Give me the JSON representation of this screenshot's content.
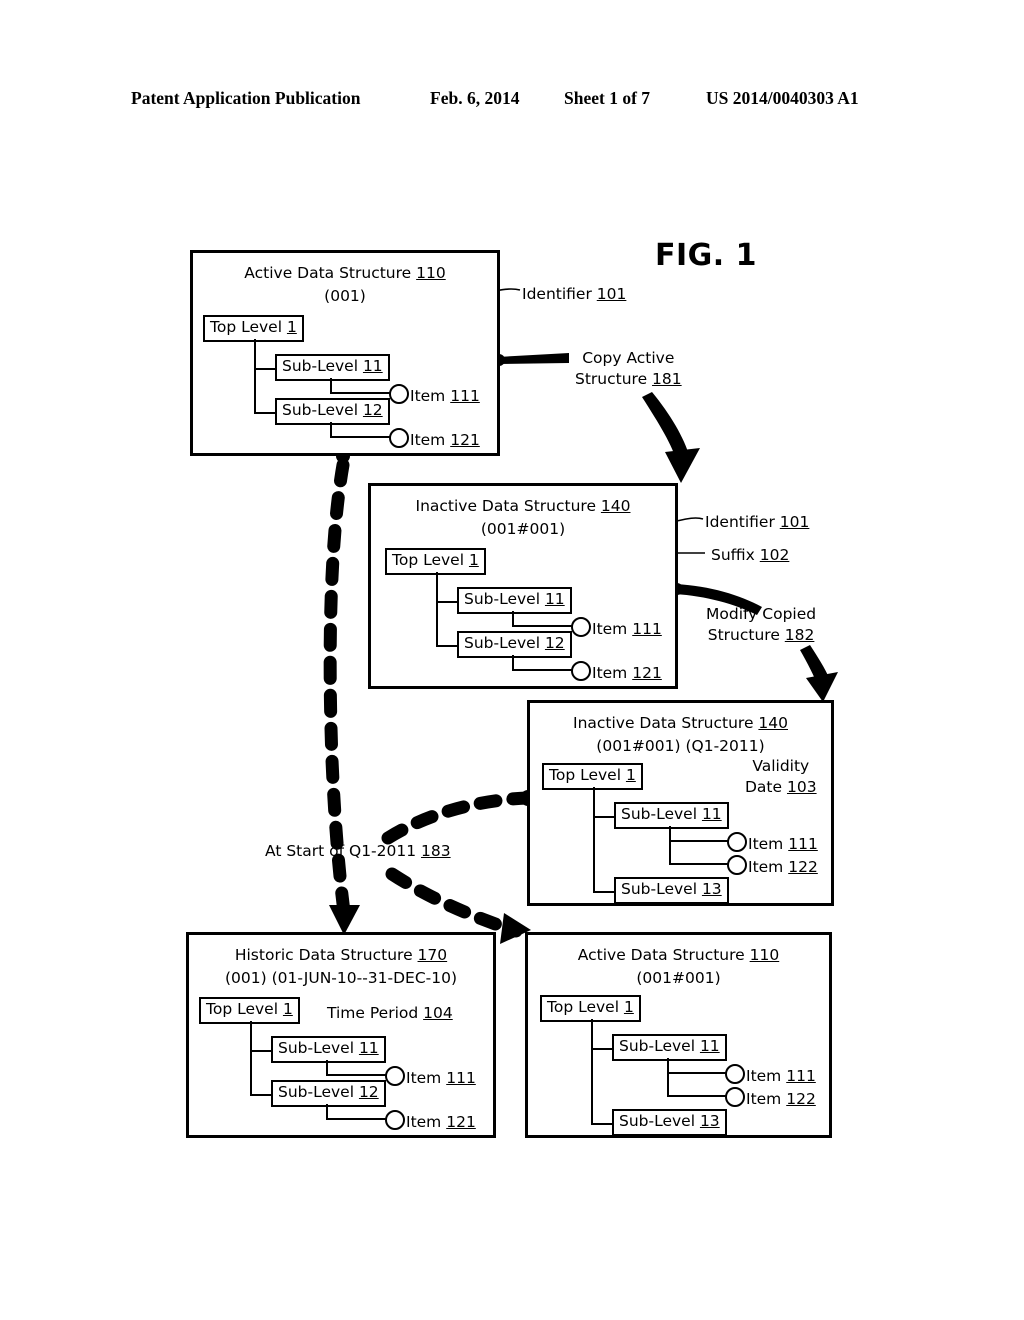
{
  "header": {
    "publication": "Patent Application Publication",
    "date": "Feb. 6, 2014",
    "sheet": "Sheet 1 of 7",
    "patent_number": "US 2014/0040303 A1"
  },
  "figure_label": "FIG. 1",
  "chart_data": {
    "type": "diagram",
    "title": "FIG. 1",
    "description": "Patent diagram showing copy-on-write versioning of a hierarchical data structure",
    "boxes": [
      {
        "id": "active-110",
        "title": "Active Data Structure 110",
        "title_text": "Active Data Structure ",
        "title_num": "110",
        "subtitle": "(001)",
        "nodes": [
          "Top Level 1",
          "Sub-Level 11",
          "Sub-Level 12"
        ],
        "items": [
          "Item 111",
          "Item 121"
        ]
      },
      {
        "id": "inactive-140-a",
        "title": "Inactive Data Structure 140",
        "subtitle": "(001#001)",
        "nodes": [
          "Top Level 1",
          "Sub-Level 11",
          "Sub-Level 12"
        ],
        "items": [
          "Item 111",
          "Item 121"
        ]
      },
      {
        "id": "inactive-140-b",
        "title": "Inactive Data Structure 140",
        "subtitle": "(001#001) (Q1-2011)",
        "nodes": [
          "Top Level 1",
          "Sub-Level 11",
          "Sub-Level 13"
        ],
        "items": [
          "Item 111",
          "Item 122"
        ]
      },
      {
        "id": "historic-170",
        "title": "Historic Data Structure 170",
        "subtitle": "(001) (01-JUN-10--31-DEC-10)",
        "nodes": [
          "Top Level 1",
          "Sub-Level 11",
          "Sub-Level 12"
        ],
        "items": [
          "Item 111",
          "Item 121"
        ]
      },
      {
        "id": "active-110-b",
        "title": "Active Data Structure 110",
        "subtitle": "(001#001)",
        "nodes": [
          "Top Level 1",
          "Sub-Level 11",
          "Sub-Level 13"
        ],
        "items": [
          "Item 111",
          "Item 122"
        ]
      }
    ],
    "callouts": [
      "Identifier 101",
      "Copy Active Structure 181",
      "Identifier 101",
      "Suffix 102",
      "Modify Copied Structure 182",
      "Validity Date 103",
      "At Start of Q1-2011 183",
      "Time Period 104"
    ]
  },
  "box1": {
    "title_text": "Active Data Structure ",
    "title_num": "110",
    "subtitle": "(001)",
    "top_level_text": "Top Level ",
    "top_level_num": "1",
    "sub1_text": "Sub-Level ",
    "sub1_num": "11",
    "sub2_text": "Sub-Level ",
    "sub2_num": "12",
    "item1_text": "Item ",
    "item1_num": "111",
    "item2_text": "Item ",
    "item2_num": "121"
  },
  "box2": {
    "title_text": "Inactive Data Structure ",
    "title_num": "140",
    "subtitle": "(001#001)",
    "top_level_text": "Top Level ",
    "top_level_num": "1",
    "sub1_text": "Sub-Level ",
    "sub1_num": "11",
    "sub2_text": "Sub-Level ",
    "sub2_num": "12",
    "item1_text": "Item ",
    "item1_num": "111",
    "item2_text": "Item ",
    "item2_num": "121"
  },
  "box3": {
    "title_text": "Inactive Data Structure ",
    "title_num": "140",
    "subtitle_a": "(001#001) ",
    "subtitle_b": "(Q1-2011)",
    "top_level_text": "Top Level ",
    "top_level_num": "1",
    "sub1_text": "Sub-Level ",
    "sub1_num": "11",
    "sub2_text": "Sub-Level ",
    "sub2_num": "13",
    "item1_text": "Item ",
    "item1_num": "111",
    "item2_text": "Item ",
    "item2_num": "122"
  },
  "box4": {
    "title_text": "Historic Data Structure ",
    "title_num": "170",
    "subtitle_a": "(001) ",
    "subtitle_b": "(01-JUN-10--31-DEC-10)",
    "top_level_text": "Top Level ",
    "top_level_num": "1",
    "sub1_text": "Sub-Level ",
    "sub1_num": "11",
    "sub2_text": "Sub-Level ",
    "sub2_num": "12",
    "item1_text": "Item ",
    "item1_num": "111",
    "item2_text": "Item ",
    "item2_num": "121"
  },
  "box5": {
    "title_text": "Active Data Structure ",
    "title_num": "110",
    "subtitle": "(001#001)",
    "top_level_text": "Top Level ",
    "top_level_num": "1",
    "sub1_text": "Sub-Level ",
    "sub1_num": "11",
    "sub2_text": "Sub-Level ",
    "sub2_num": "13",
    "item1_text": "Item ",
    "item1_num": "111",
    "item2_text": "Item ",
    "item2_num": "122"
  },
  "callouts": {
    "identifier1_text": "Identifier ",
    "identifier1_num": "101",
    "copy_active_l1": "Copy Active",
    "copy_active_l2_text": "Structure ",
    "copy_active_l2_num": "181",
    "identifier2_text": "Identifier ",
    "identifier2_num": "101",
    "suffix_text": "Suffix ",
    "suffix_num": "102",
    "modify_l1": "Modify Copied",
    "modify_l2_text": "Structure ",
    "modify_l2_num": "182",
    "validity_l1": "Validity",
    "validity_l2_text": "Date ",
    "validity_l2_num": "103",
    "at_start_text": "At Start of Q1-2011 ",
    "at_start_num": "183",
    "time_period_text": "Time Period ",
    "time_period_num": "104"
  }
}
